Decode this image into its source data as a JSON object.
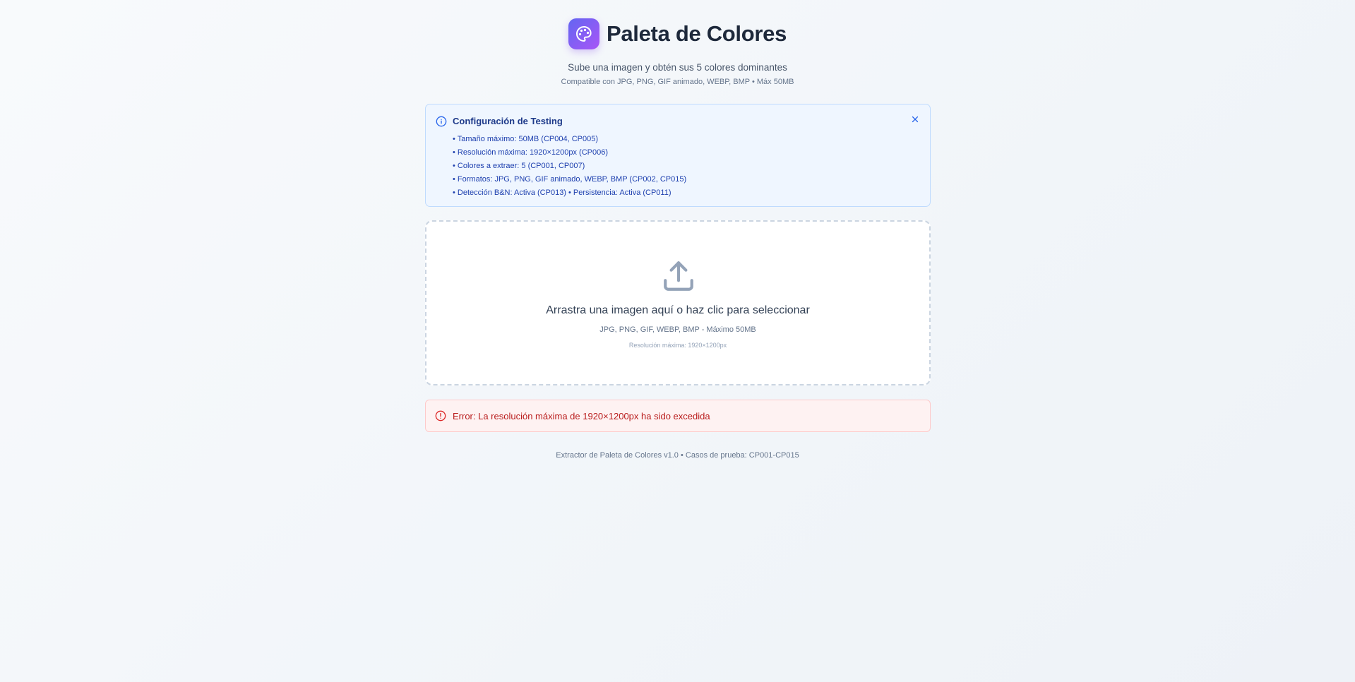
{
  "header": {
    "title": "Paleta de Colores",
    "subtitle": "Sube una imagen y obtén sus 5 colores dominantes",
    "formats": "Compatible con JPG, PNG, GIF animado, WEBP, BMP • Máx 50MB",
    "logo_icon": "palette-icon"
  },
  "info": {
    "title": "Configuración de Testing",
    "icon": "info-icon",
    "close_icon": "close-icon",
    "items": [
      "• Tamaño máximo: 50MB (CP004, CP005)",
      "• Resolución máxima: 1920×1200px (CP006)",
      "• Colores a extraer: 5 (CP001, CP007)",
      "• Formatos: JPG, PNG, GIF animado, WEBP, BMP (CP002, CP015)",
      "• Detección B&N: Activa (CP013) • Persistencia: Activa (CP011)"
    ]
  },
  "dropzone": {
    "icon": "upload-icon",
    "main_text": "Arrastra una imagen aquí o haz clic para seleccionar",
    "formats_text": "JPG, PNG, GIF, WEBP, BMP - Máximo 50MB",
    "resolution_text": "Resolución máxima: 1920×1200px"
  },
  "error": {
    "icon": "alert-circle-icon",
    "message": "Error: La resolución máxima de 1920×1200px ha sido excedida"
  },
  "footer": {
    "text": "Extractor de Paleta de Colores v1.0 • Casos de prueba: CP001-CP015"
  },
  "colors": {
    "accent_start": "#6366f1",
    "accent_end": "#a855f7",
    "info_bg": "#eff6ff",
    "info_text": "#1e40af",
    "error_bg": "#fef2f2",
    "error_text": "#b91c1c"
  }
}
